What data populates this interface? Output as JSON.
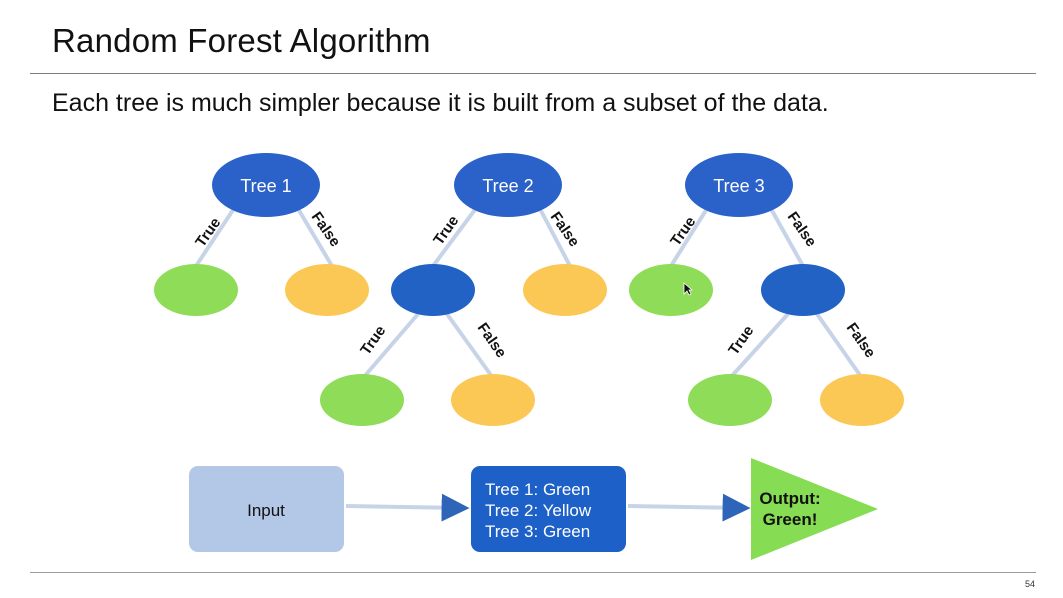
{
  "slide": {
    "title": "Random Forest Algorithm",
    "subtitle": "Each tree is much simpler because it is built from a subset of the data.",
    "page_number": "54"
  },
  "colors": {
    "root_node": "#2a62c9",
    "internal_node": "#2162c4",
    "leaf_true": "#8fdc59",
    "leaf_false": "#fcc855",
    "edge": "#c7d4e8",
    "input_box": "#b3c7e6",
    "results_box": "#1d60c7",
    "output_triangle": "#86dc52",
    "arrow": "#2f65b9"
  },
  "edge_labels": {
    "true_label": "True",
    "false_label": "False"
  },
  "trees": [
    {
      "root_label": "Tree 1"
    },
    {
      "root_label": "Tree 2"
    },
    {
      "root_label": "Tree 3"
    }
  ],
  "flow": {
    "input_label": "Input",
    "results": [
      "Tree 1: Green",
      "Tree 2: Yellow",
      "Tree 3: Green"
    ],
    "output_label_line1": "Output:",
    "output_label_line2": "Green!"
  }
}
